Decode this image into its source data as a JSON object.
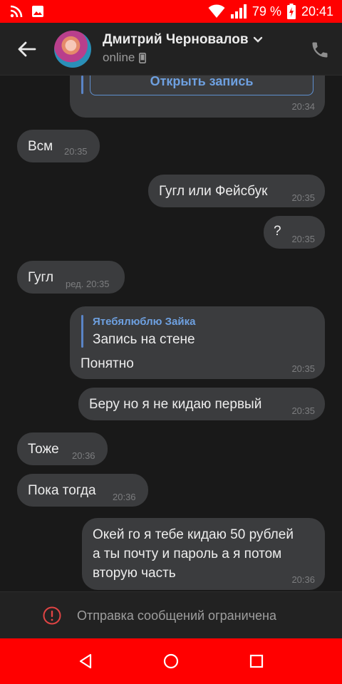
{
  "status_bar": {
    "battery_percent": "79 %",
    "time": "20:41",
    "icons": [
      "rss-icon",
      "image-icon",
      "wifi-icon",
      "signal-icon",
      "battery-charging-icon"
    ]
  },
  "header": {
    "contact_name": "Дмитрий Черновалов",
    "status": "online",
    "icons": [
      "back-arrow-icon",
      "chevron-down-icon",
      "phone-device-icon",
      "phone-call-icon"
    ]
  },
  "messages": [
    {
      "id": "m0",
      "side": "out",
      "button_label": "Открыть запись",
      "time": "20:34"
    },
    {
      "id": "m1",
      "side": "in",
      "text": "Всм",
      "time": "20:35"
    },
    {
      "id": "m2",
      "side": "out",
      "text": "Гугл или Фейсбук",
      "time": "20:35"
    },
    {
      "id": "m3",
      "side": "out",
      "text": "?",
      "time": "20:35"
    },
    {
      "id": "m4",
      "side": "in",
      "text": "Гугл",
      "time": "ред. 20:35"
    },
    {
      "id": "m5",
      "side": "out",
      "quote_author": "Ятебялюблю Зайка",
      "quote_text": "Запись на стене",
      "text": "Понятно",
      "time": "20:35"
    },
    {
      "id": "m6",
      "side": "out",
      "text": "Беру но я не кидаю первый",
      "time": "20:35"
    },
    {
      "id": "m7",
      "side": "in",
      "text": "Тоже",
      "time": "20:36"
    },
    {
      "id": "m8",
      "side": "in",
      "text": "Пока тогда",
      "time": "20:36"
    },
    {
      "id": "m9",
      "side": "out",
      "lines": [
        "Окей го я тебе кидаю 50 рублей",
        "а ты почту и пароль а я потом",
        "вторую часть"
      ],
      "time": "20:36"
    }
  ],
  "restriction": {
    "text": "Отправка сообщений ограничена",
    "icon": "warning-circle-icon"
  },
  "nav_bar": {
    "icons": [
      "nav-back-icon",
      "nav-home-icon",
      "nav-recents-icon"
    ]
  },
  "colors": {
    "system_bars": "#ff0000",
    "background": "#191919",
    "bubble": "#3b3c3e",
    "accent": "#6ea0e0",
    "warning": "#e04444"
  }
}
